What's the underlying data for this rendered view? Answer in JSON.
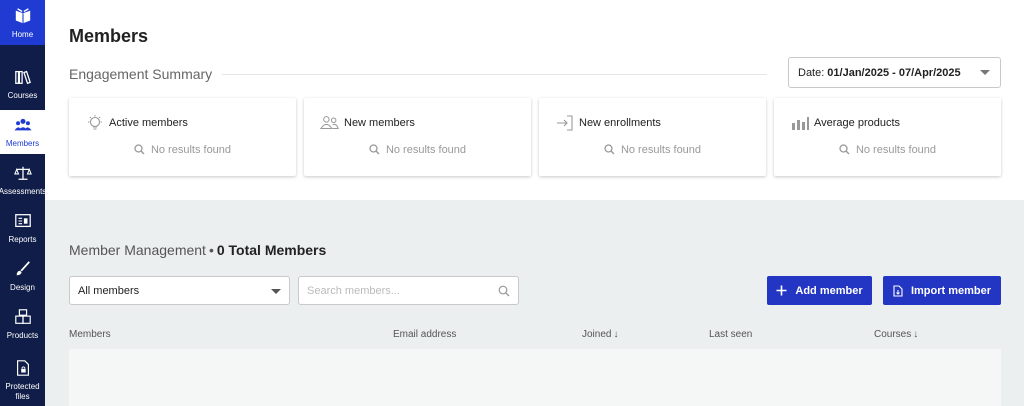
{
  "sidebar": {
    "items": [
      {
        "label": "Home",
        "icon": "book-open-icon"
      },
      {
        "label": "Courses",
        "icon": "books-icon"
      },
      {
        "label": "Members",
        "icon": "users-icon"
      },
      {
        "label": "Assessments",
        "icon": "scales-icon"
      },
      {
        "label": "Reports",
        "icon": "report-icon"
      },
      {
        "label": "Design",
        "icon": "brush-icon"
      },
      {
        "label": "Products",
        "icon": "boxes-icon"
      },
      {
        "label": "Protected files",
        "icon": "file-lock-icon"
      }
    ],
    "active": "Members"
  },
  "header": {
    "title": "Members",
    "engagement_title": "Engagement Summary",
    "date_label": "Date:",
    "date_value": "01/Jan/2025 - 07/Apr/2025"
  },
  "cards": [
    {
      "title": "Active members",
      "icon": "lightbulb-icon",
      "empty_text": "No results found"
    },
    {
      "title": "New members",
      "icon": "users-outline-icon",
      "empty_text": "No results found"
    },
    {
      "title": "New enrollments",
      "icon": "sign-in-icon",
      "empty_text": "No results found"
    },
    {
      "title": "Average products",
      "icon": "bar-chart-icon",
      "empty_text": "No results found"
    }
  ],
  "management": {
    "title": "Member Management",
    "separator": "•",
    "count_text": "0 Total Members",
    "filter_value": "All members",
    "search_placeholder": "Search members...",
    "add_button": "Add member",
    "import_button": "Import member",
    "columns": [
      {
        "label": "Members",
        "sortable": false
      },
      {
        "label": "Email address",
        "sortable": false
      },
      {
        "label": "Joined",
        "sortable": true
      },
      {
        "label": "Last seen",
        "sortable": false
      },
      {
        "label": "Courses",
        "sortable": true
      }
    ]
  },
  "colors": {
    "sidebar_bg": "#0f1d48",
    "accent": "#1f3bd1",
    "button": "#2235c3",
    "section_bg": "#ebeff0"
  }
}
